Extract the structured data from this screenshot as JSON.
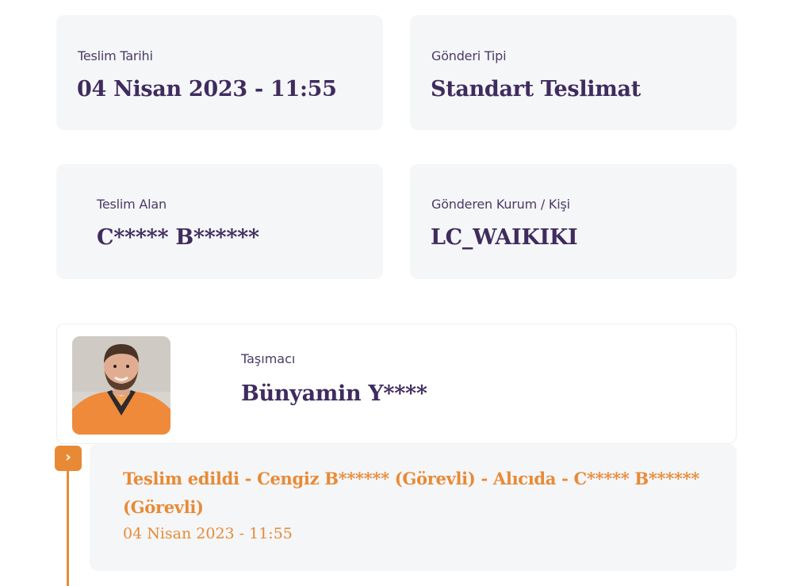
{
  "info_cards": {
    "delivery_date": {
      "label": "Teslim Tarihi",
      "value": "04 Nisan 2023 - 11:55"
    },
    "shipment_type": {
      "label": "Gönderi Tipi",
      "value": "Standart Teslimat"
    },
    "receiver": {
      "label": "Teslim Alan",
      "value": "C***** B******"
    },
    "sender": {
      "label": "Gönderen Kurum / Kişi",
      "value": "LC_WAIKIKI"
    }
  },
  "carrier": {
    "label": "Taşımacı",
    "name": "Bünyamin Y****"
  },
  "timeline": {
    "marker_icon": "chevron-right-icon",
    "marker_glyph": "›",
    "events": [
      {
        "title": "Teslim edildi - Cengiz B****** (Görevli) - Alıcıda - C***** B****** (Görevli)",
        "date": "04 Nisan 2023 - 11:55"
      }
    ]
  },
  "colors": {
    "accent": "#e88a35",
    "text_primary": "#3f2c5e",
    "card_background": "#f5f6f8"
  }
}
